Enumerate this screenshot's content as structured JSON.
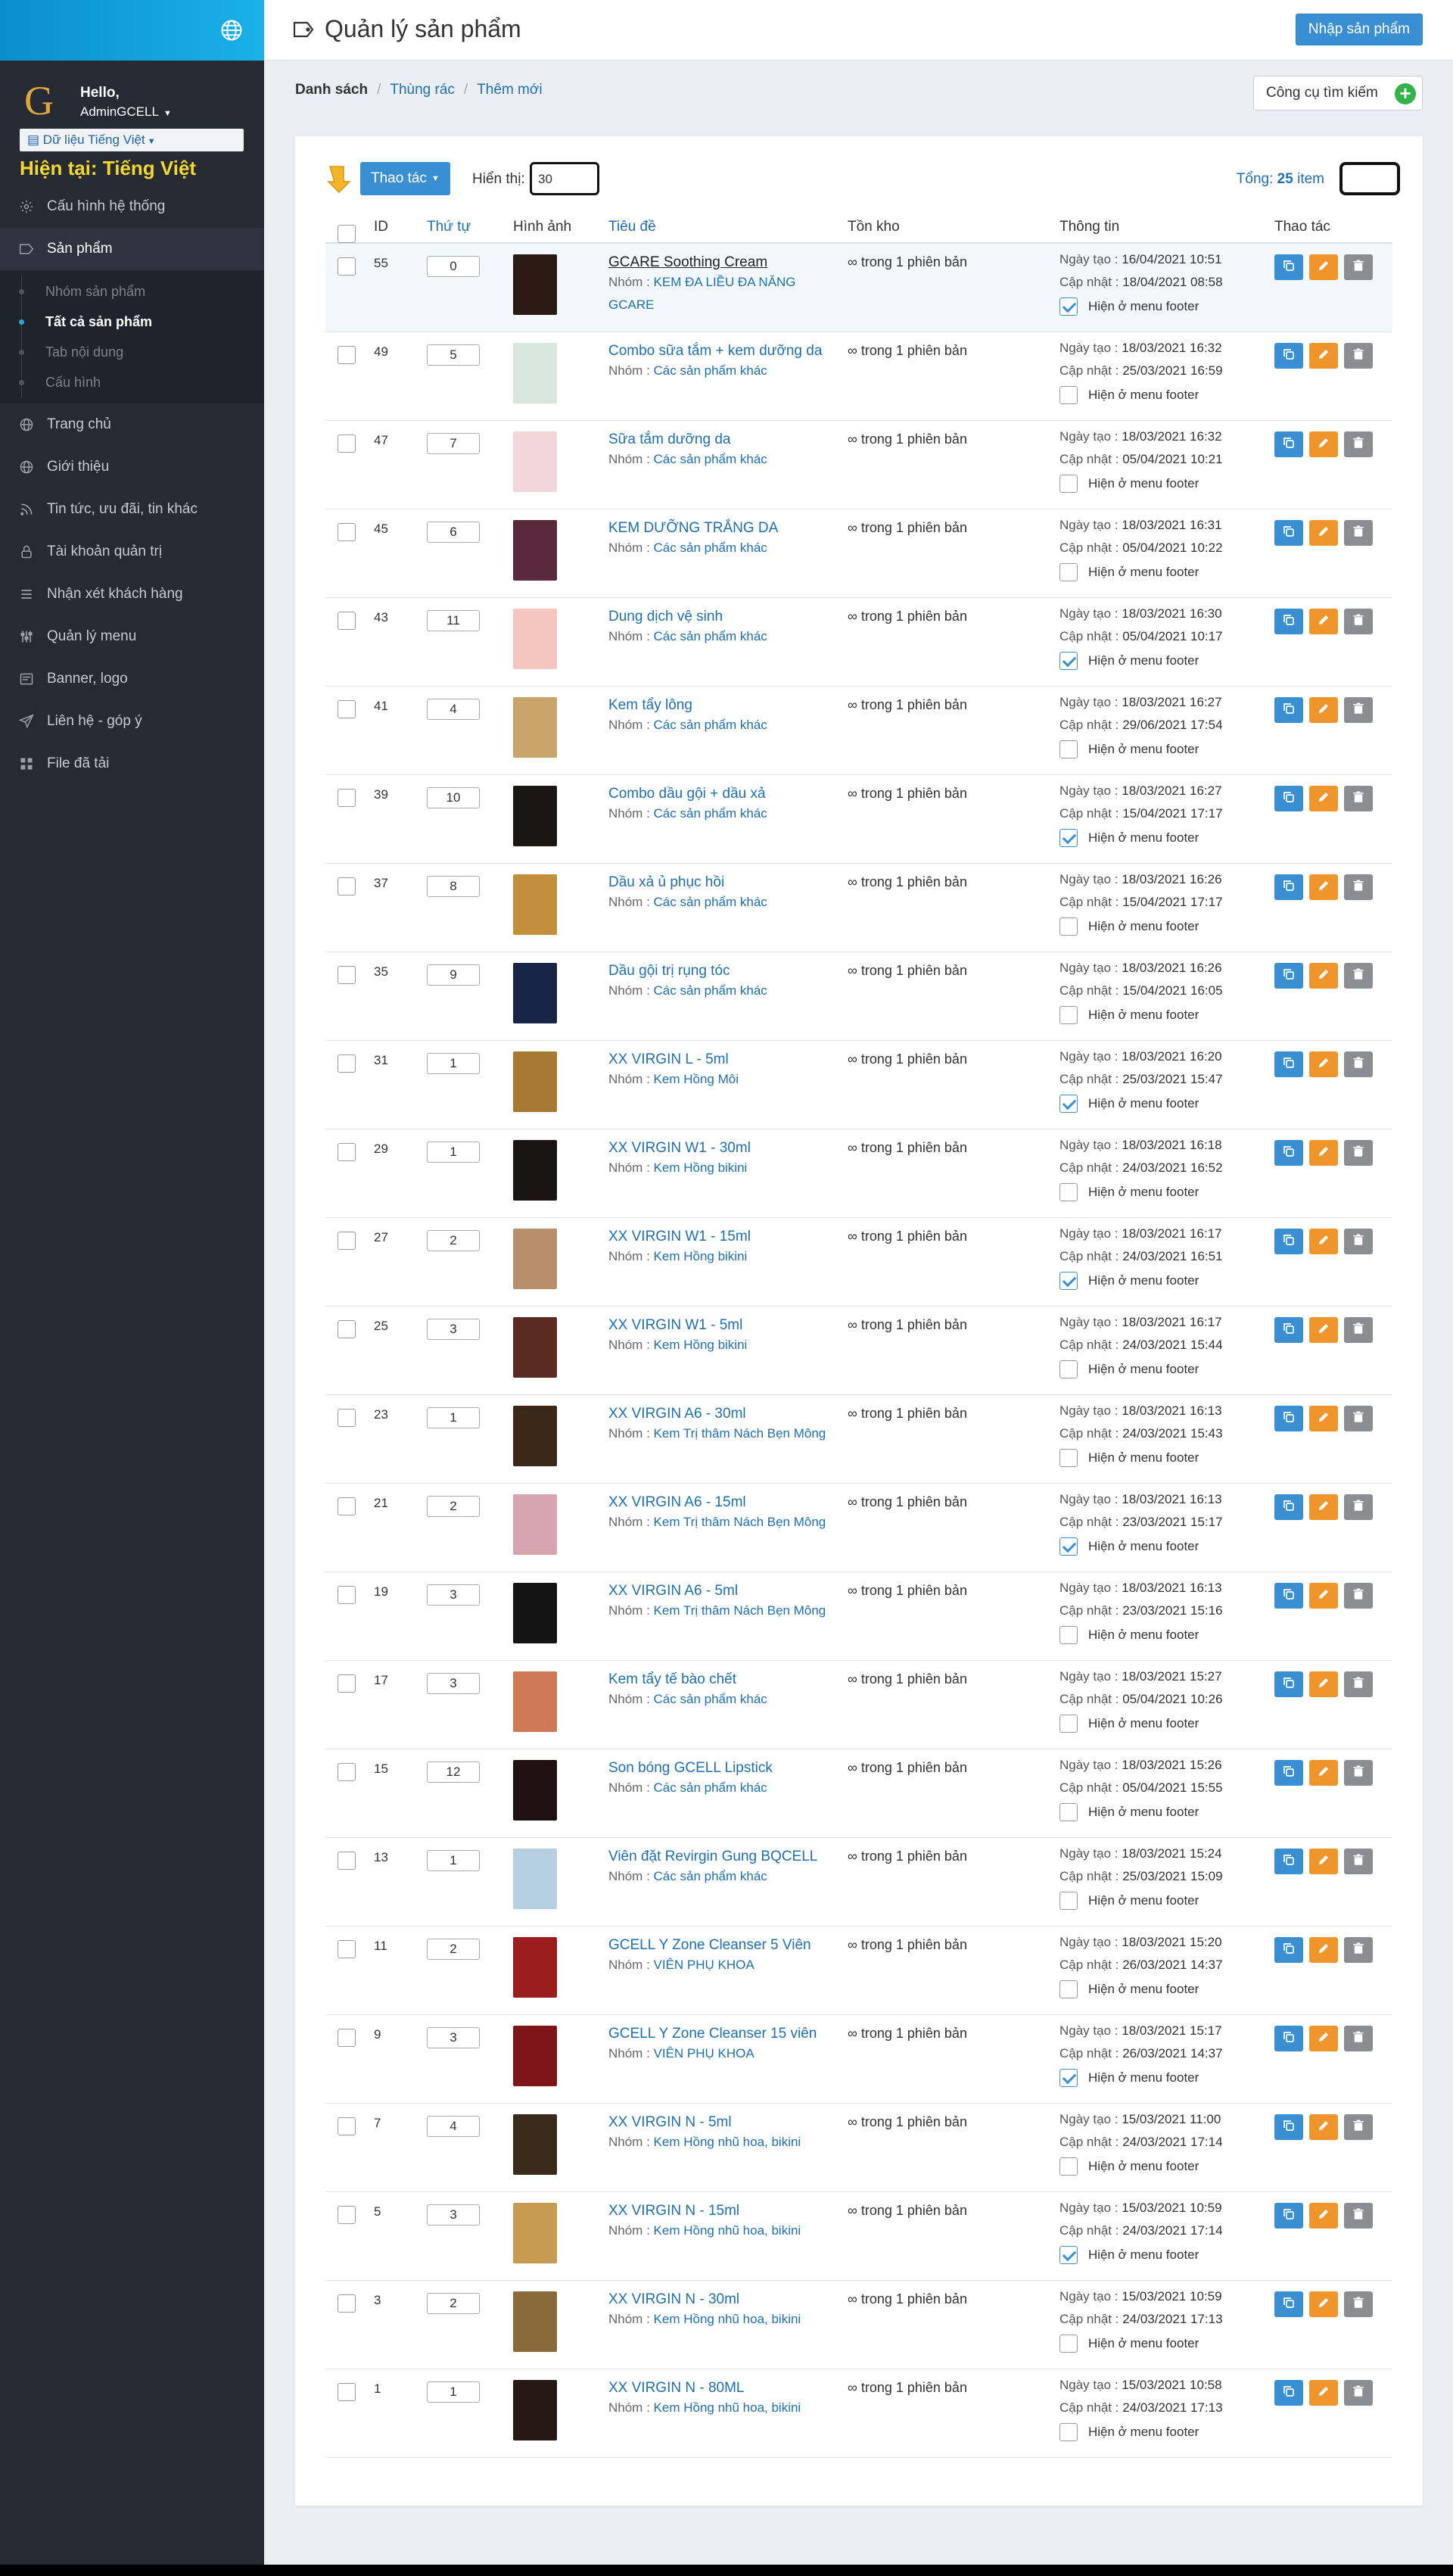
{
  "sidebar": {
    "logo_letter": "G",
    "hello": "Hello,",
    "admin": "AdminGCELL",
    "lang_btn": "Dữ liệu Tiếng Việt",
    "current_lang": "Hiện tại: Tiếng Việt",
    "menu": [
      {
        "label": "Cấu hình hệ thống",
        "icon": "gear-icon"
      },
      {
        "label": "Sản phẩm",
        "icon": "tag-icon",
        "active": true,
        "sub": [
          "Nhóm sản phẩm",
          "Tất cả sản phẩm",
          "Tab nội dung",
          "Cấu hình"
        ]
      },
      {
        "label": "Trang chủ",
        "icon": "globe-icon"
      },
      {
        "label": "Giới thiệu",
        "icon": "globe-icon"
      },
      {
        "label": "Tin tức, ưu đãi, tin khác",
        "icon": "rss-icon"
      },
      {
        "label": "Tài khoản quản trị",
        "icon": "lock-icon"
      },
      {
        "label": "Nhận xét khách hàng",
        "icon": "list-icon"
      },
      {
        "label": "Quản lý menu",
        "icon": "sliders-icon"
      },
      {
        "label": "Banner, logo",
        "icon": "image-icon"
      },
      {
        "label": "Liên hệ - góp ý",
        "icon": "send-icon"
      },
      {
        "label": "File đã tải",
        "icon": "grid-icon"
      }
    ]
  },
  "header": {
    "title": "Quản lý sản phẩm",
    "import_btn": "Nhập sản phẩm"
  },
  "crumbs": {
    "list": "Danh sách",
    "trash": "Thùng rác",
    "new": "Thêm mới"
  },
  "search_tool": "Công cụ tìm kiếm",
  "toolbar": {
    "actions": "Thao tác",
    "show_label": "Hiển thị:",
    "show_value": "30",
    "total_label": "Tổng:",
    "total_count": "25",
    "total_unit": "item"
  },
  "columns": [
    "ID",
    "Thứ tự",
    "Hình ảnh",
    "Tiêu đề",
    "Tồn kho",
    "Thông tin",
    "Thao tác"
  ],
  "labels": {
    "group": "Nhóm :",
    "created": "Ngày tạo :",
    "updated": "Cập nhật :",
    "footer": "Hiện ở menu footer",
    "stock": "∞ trong 1 phiên bản"
  },
  "products": [
    {
      "id": "55",
      "order": "0",
      "title": "GCARE Soothing Cream",
      "group": "KEM ĐA LIỀU ĐA NĂNG GCARE",
      "created": "16/04/2021 10:51",
      "updated": "18/04/2021 08:58",
      "footer": true,
      "thumb": "#2a1a12"
    },
    {
      "id": "49",
      "order": "5",
      "title": "Combo sữa tắm + kem dưỡng da",
      "group": "Các sản phẩm khác",
      "created": "18/03/2021 16:32",
      "updated": "25/03/2021 16:59",
      "footer": false,
      "thumb": "#d9e6dc"
    },
    {
      "id": "47",
      "order": "7",
      "title": "Sữa tắm dưỡng da",
      "group": "Các sản phẩm khác",
      "created": "18/03/2021 16:32",
      "updated": "05/04/2021 10:21",
      "footer": false,
      "thumb": "#f1d6da"
    },
    {
      "id": "45",
      "order": "6",
      "title": "KEM DƯỠNG TRẮNG DA",
      "group": "Các sản phẩm khác",
      "created": "18/03/2021 16:31",
      "updated": "05/04/2021 10:22",
      "footer": false,
      "thumb": "#5a2a3c"
    },
    {
      "id": "43",
      "order": "11",
      "title": "Dung dịch vệ sinh",
      "group": "Các sản phẩm khác",
      "created": "18/03/2021 16:30",
      "updated": "05/04/2021 10:17",
      "footer": true,
      "thumb": "#f3c6c0"
    },
    {
      "id": "41",
      "order": "4",
      "title": "Kem tẩy lông",
      "group": "Các sản phẩm khác",
      "created": "18/03/2021 16:27",
      "updated": "29/06/2021 17:54",
      "footer": false,
      "thumb": "#c9a468"
    },
    {
      "id": "39",
      "order": "10",
      "title": "Combo dầu gội + dầu xả",
      "group": "Các sản phẩm khác",
      "created": "18/03/2021 16:27",
      "updated": "15/04/2021 17:17",
      "footer": true,
      "thumb": "#1c1612"
    },
    {
      "id": "37",
      "order": "8",
      "title": "Dầu xả ủ phục hồi",
      "group": "Các sản phẩm khác",
      "created": "18/03/2021 16:26",
      "updated": "15/04/2021 17:17",
      "footer": false,
      "thumb": "#c48f3a"
    },
    {
      "id": "35",
      "order": "9",
      "title": "Dầu gội trị rụng tóc",
      "group": "Các sản phẩm khác",
      "created": "18/03/2021 16:26",
      "updated": "15/04/2021 16:05",
      "footer": false,
      "thumb": "#172446"
    },
    {
      "id": "31",
      "order": "1",
      "title": "XX VIRGIN L - 5ml",
      "group": "Kem Hồng Môi",
      "created": "18/03/2021 16:20",
      "updated": "25/03/2021 15:47",
      "footer": true,
      "thumb": "#a77832"
    },
    {
      "id": "29",
      "order": "1",
      "title": "XX VIRGIN W1 - 30ml",
      "group": "Kem Hồng bikini",
      "created": "18/03/2021 16:18",
      "updated": "24/03/2021 16:52",
      "footer": false,
      "thumb": "#1a1514"
    },
    {
      "id": "27",
      "order": "2",
      "title": "XX VIRGIN W1 - 15ml",
      "group": "Kem Hồng bikini",
      "created": "18/03/2021 16:17",
      "updated": "24/03/2021 16:51",
      "footer": true,
      "thumb": "#b6906a"
    },
    {
      "id": "25",
      "order": "3",
      "title": "XX VIRGIN W1 - 5ml",
      "group": "Kem Hồng bikini",
      "created": "18/03/2021 16:17",
      "updated": "24/03/2021 15:44",
      "footer": false,
      "thumb": "#5b2b22"
    },
    {
      "id": "23",
      "order": "1",
      "title": "XX VIRGIN A6 - 30ml",
      "group": "Kem Trị thâm Nách Bẹn Mông",
      "created": "18/03/2021 16:13",
      "updated": "24/03/2021 15:43",
      "footer": false,
      "thumb": "#3d2718"
    },
    {
      "id": "21",
      "order": "2",
      "title": "XX VIRGIN A6 - 15ml",
      "group": "Kem Trị thâm Nách Bẹn Mông",
      "created": "18/03/2021 16:13",
      "updated": "23/03/2021 15:17",
      "footer": true,
      "thumb": "#d6a3ae"
    },
    {
      "id": "19",
      "order": "3",
      "title": "XX VIRGIN A6 - 5ml",
      "group": "Kem Trị thâm Nách Bẹn Mông",
      "created": "18/03/2021 16:13",
      "updated": "23/03/2021 15:16",
      "footer": false,
      "thumb": "#141414"
    },
    {
      "id": "17",
      "order": "3",
      "title": "Kem tẩy tế bào chết",
      "group": "Các sản phẩm khác",
      "created": "18/03/2021 15:27",
      "updated": "05/04/2021 10:26",
      "footer": false,
      "thumb": "#cf7a55"
    },
    {
      "id": "15",
      "order": "12",
      "title": "Son bóng GCELL Lipstick",
      "group": "Các sản phẩm khác",
      "created": "18/03/2021 15:26",
      "updated": "05/04/2021 15:55",
      "footer": false,
      "thumb": "#1d1210"
    },
    {
      "id": "13",
      "order": "1",
      "title": "Viên đặt Revirgin Gung BQCELL",
      "group": "Các sản phẩm khác",
      "created": "18/03/2021 15:24",
      "updated": "25/03/2021 15:09",
      "footer": false,
      "thumb": "#b6cfe0"
    },
    {
      "id": "11",
      "order": "2",
      "title": "GCELL Y Zone Cleanser 5 Viên",
      "group": "VIÊN PHỤ KHOA",
      "created": "18/03/2021 15:20",
      "updated": "26/03/2021 14:37",
      "footer": false,
      "thumb": "#9a1c1c"
    },
    {
      "id": "9",
      "order": "3",
      "title": "GCELL Y Zone Cleanser 15 viên",
      "group": "VIÊN PHỤ KHOA",
      "created": "18/03/2021 15:17",
      "updated": "26/03/2021 14:37",
      "footer": true,
      "thumb": "#7e1618"
    },
    {
      "id": "7",
      "order": "4",
      "title": "XX VIRGIN N - 5ml",
      "group": "Kem Hồng nhũ hoa, bikini",
      "created": "15/03/2021 11:00",
      "updated": "24/03/2021 17:14",
      "footer": false,
      "thumb": "#3a2a1c"
    },
    {
      "id": "5",
      "order": "3",
      "title": "XX VIRGIN N - 15ml",
      "group": "Kem Hồng nhũ hoa, bikini",
      "created": "15/03/2021 10:59",
      "updated": "24/03/2021 17:14",
      "footer": true,
      "thumb": "#c79a52"
    },
    {
      "id": "3",
      "order": "2",
      "title": "XX VIRGIN N - 30ml",
      "group": "Kem Hồng nhũ hoa, bikini",
      "created": "15/03/2021 10:59",
      "updated": "24/03/2021 17:13",
      "footer": false,
      "thumb": "#8a6a3a"
    },
    {
      "id": "1",
      "order": "1",
      "title": "XX VIRGIN N - 80ML",
      "group": "Kem Hồng nhũ hoa, bikini",
      "created": "15/03/2021 10:58",
      "updated": "24/03/2021 17:13",
      "footer": false,
      "thumb": "#241812"
    }
  ]
}
